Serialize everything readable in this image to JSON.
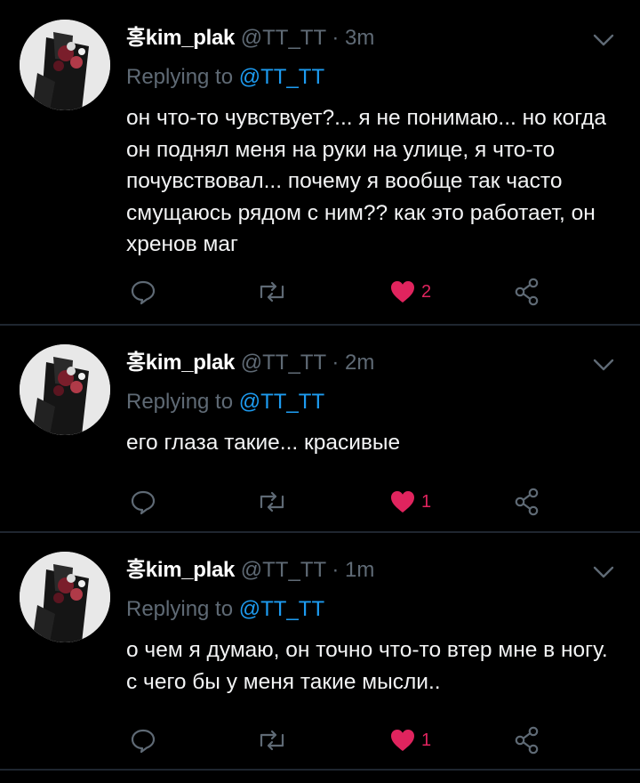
{
  "tweets": [
    {
      "name": "홍kim_plak",
      "handle": "@TT_TT",
      "separator": "·",
      "time": "3m",
      "reply_label": "Replying to",
      "reply_target": "@TT_TT",
      "text": "он что-то чувствует?... я не понимаю... но когда он поднял меня на руки на улице, я что-то почувствовал... почему я вообще так часто смущаюсь рядом с ним?? как это работает, он хренов маг",
      "likes": "2",
      "liked": true
    },
    {
      "name": "홍kim_plak",
      "handle": "@TT_TT",
      "separator": "·",
      "time": "2m",
      "reply_label": "Replying to",
      "reply_target": "@TT_TT",
      "text": "его глаза такие... красивые",
      "likes": "1",
      "liked": true
    },
    {
      "name": "홍kim_plak",
      "handle": "@TT_TT",
      "separator": "·",
      "time": "1m",
      "reply_label": "Replying to",
      "reply_target": "@TT_TT",
      "text": "о чем я думаю, он точно что-то втер мне в ногу. с чего бы у меня такие мысли..",
      "likes": "1",
      "liked": true
    }
  ],
  "icons": {
    "reply": "comment-icon",
    "retweet": "retweet-icon",
    "like": "heart-icon",
    "share": "share-icon",
    "menu": "chevron-down-icon"
  },
  "colors": {
    "background": "#000000",
    "muted": "#5f6a75",
    "link": "#1d9bf0",
    "like": "#e0245e",
    "divider": "#1f2630"
  }
}
